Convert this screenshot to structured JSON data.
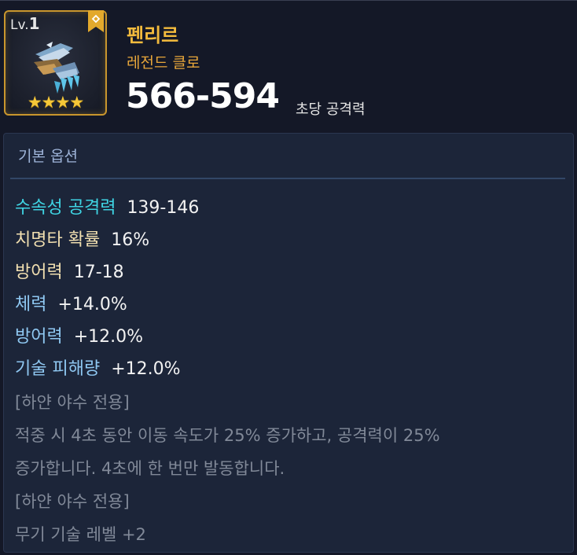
{
  "item": {
    "level_prefix": "Lv.",
    "level": "1",
    "stars": "★★★★",
    "name": "펜리르",
    "grade": "레전드 클로",
    "dps": "566-594",
    "dps_label": "초당 공격력",
    "bookmark_icon": "bookmark-icon",
    "art_icon": "claw-weapon-icon"
  },
  "colors": {
    "name": "#f3bb3d",
    "grade": "#e7a63a",
    "frame": "#c9962d",
    "element_stat": "#3fd4e3",
    "base_stat": "#f1dfb0",
    "bonus_stat": "#8fc8f2",
    "description": "#818998"
  },
  "options": {
    "title": "기본 옵션",
    "stats": [
      {
        "label": "수속성 공격력",
        "value": "139-146"
      },
      {
        "label": "치명타 확률",
        "value": "16%"
      },
      {
        "label": "방어력",
        "value": "17-18"
      },
      {
        "label": "체력",
        "value": "+14.0%"
      },
      {
        "label": "방어력",
        "value": "+12.0%"
      },
      {
        "label": "기술 피해량",
        "value": "+12.0%"
      }
    ],
    "exclusive": [
      {
        "header": "[하얀 야수 전용]",
        "lines": [
          "적중 시 4초 동안 이동 속도가 25% 증가하고, 공격력이 25%",
          "증가합니다. 4초에 한 번만 발동합니다."
        ]
      },
      {
        "header": "[하얀 야수 전용]",
        "lines": [
          "무기 기술 레벨 +2"
        ]
      }
    ]
  }
}
